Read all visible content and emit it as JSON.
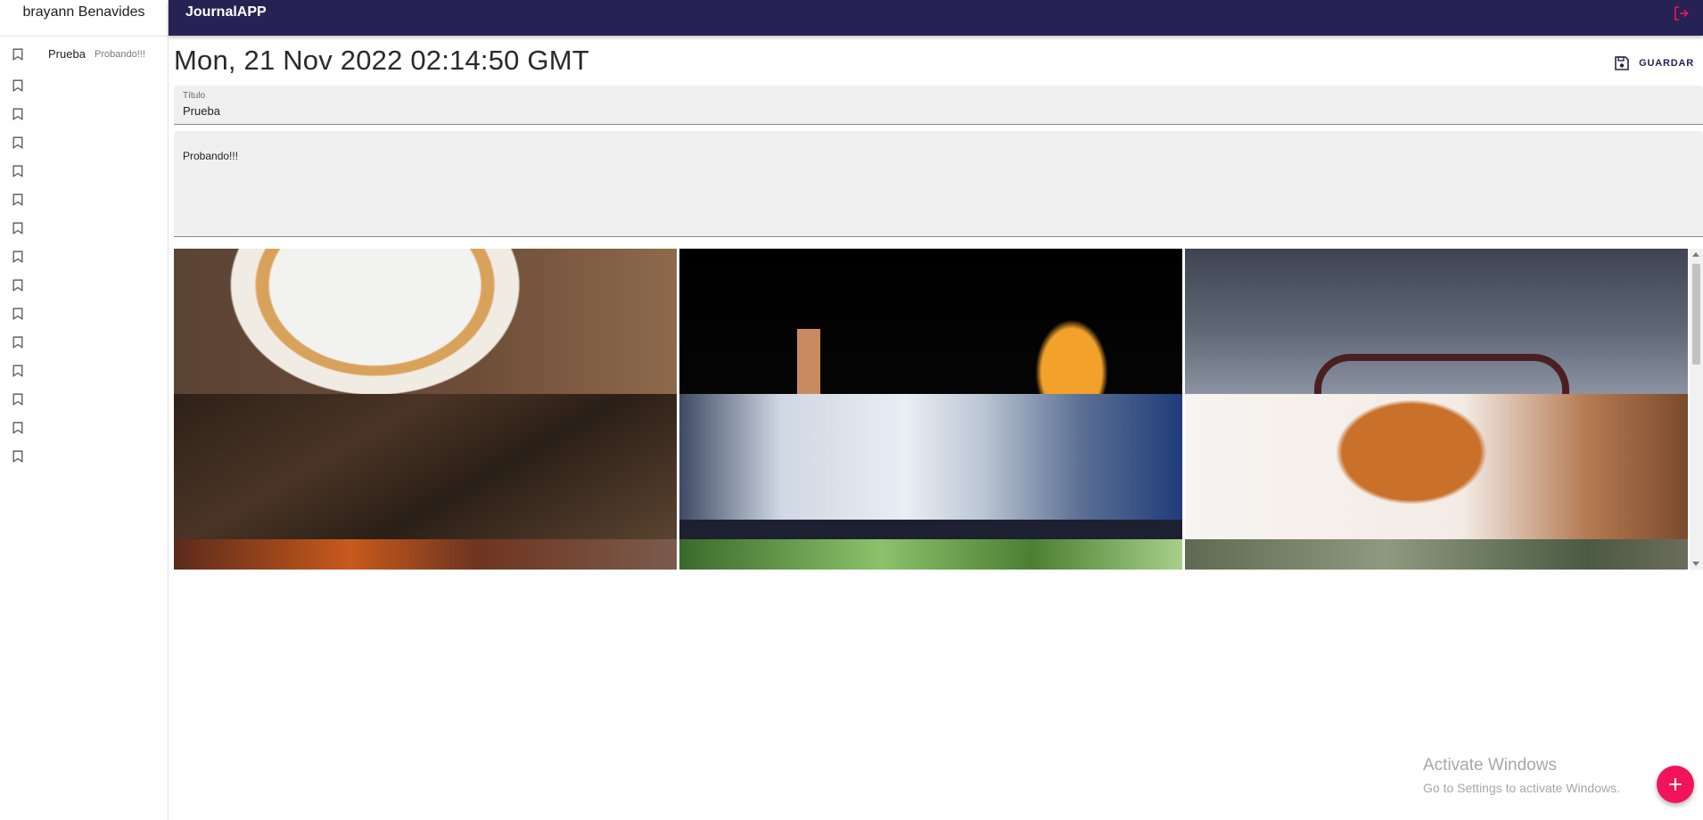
{
  "sidebar": {
    "username": "brayann Benavides",
    "notes": [
      {
        "title": "Prueba",
        "body": "Probando!!!"
      },
      {
        "title": "",
        "body": ""
      },
      {
        "title": "",
        "body": ""
      },
      {
        "title": "",
        "body": ""
      },
      {
        "title": "",
        "body": ""
      },
      {
        "title": "",
        "body": ""
      },
      {
        "title": "",
        "body": ""
      },
      {
        "title": "",
        "body": ""
      },
      {
        "title": "",
        "body": ""
      },
      {
        "title": "",
        "body": ""
      },
      {
        "title": "",
        "body": ""
      },
      {
        "title": "",
        "body": ""
      },
      {
        "title": "",
        "body": ""
      },
      {
        "title": "",
        "body": ""
      },
      {
        "title": "",
        "body": ""
      }
    ]
  },
  "appbar": {
    "title": "JournalAPP",
    "logout_icon": "logout-icon"
  },
  "note": {
    "date": "Mon, 21 Nov 2022 02:14:50 GMT",
    "save_label": "GUARDAR",
    "save_icon": "save-icon",
    "title_label": "Título",
    "title_value": "Prueba",
    "body_value": "Probando!!!"
  },
  "gallery": {
    "images": [
      "croissant-plate",
      "french-fries",
      "handbag",
      "wood-texture",
      "hats",
      "honey-dipper",
      "grilled-food",
      "green-leaves",
      "forest-path"
    ]
  },
  "watermark": {
    "line1": "Activate Windows",
    "line2": "Go to Settings to activate Windows."
  },
  "fab": {
    "icon": "plus-icon"
  },
  "colors": {
    "appbar": "#262254",
    "fab": "#f2145a",
    "logout": "#f2145a",
    "field_bg": "#f0f0f0"
  }
}
